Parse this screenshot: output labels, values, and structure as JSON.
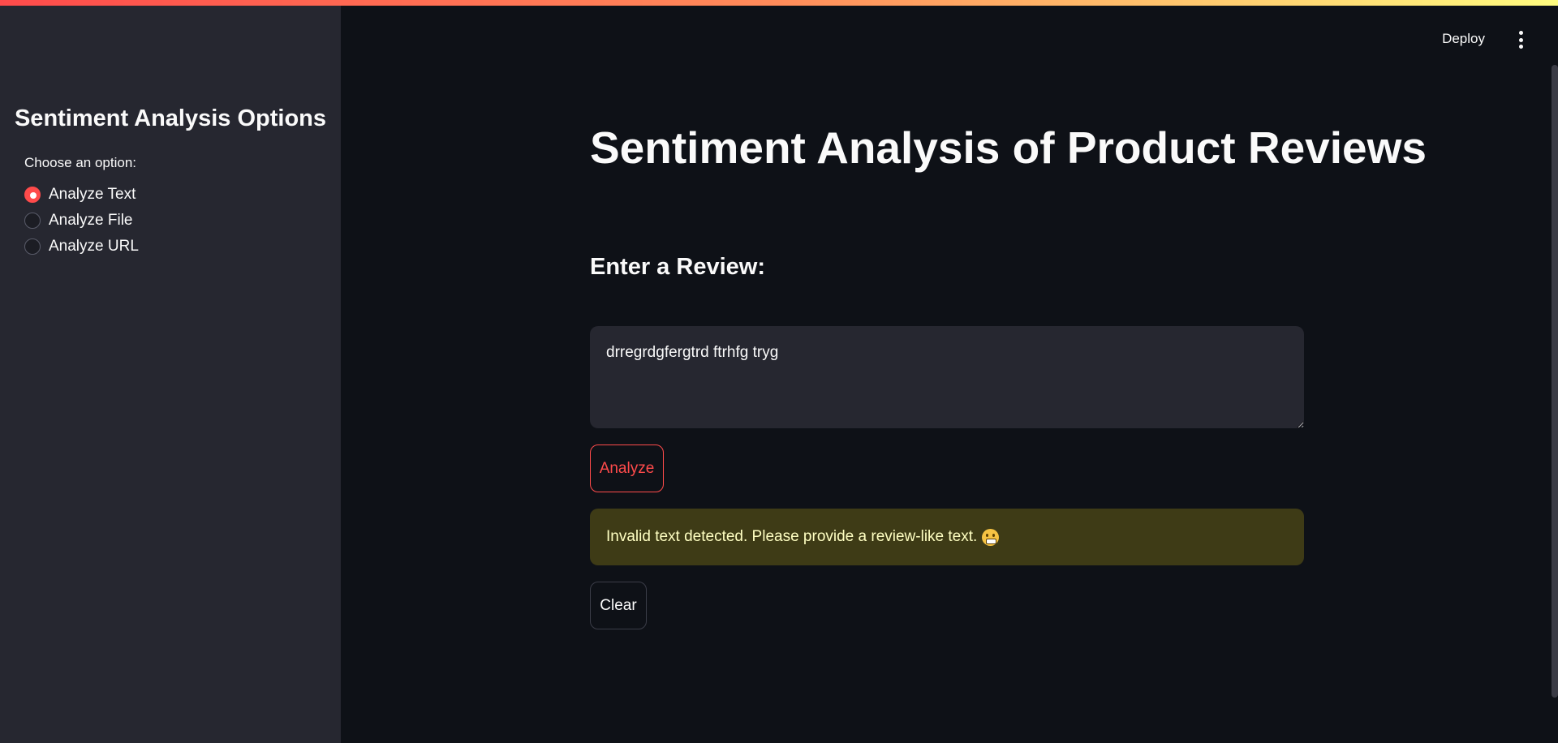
{
  "colors": {
    "primary": "#ff4b4b",
    "background": "#0e1117",
    "sidebar_background": "#262730",
    "warning_background": "#3e3b16",
    "warning_text": "#ffffc2"
  },
  "header": {
    "deploy_label": "Deploy",
    "menu_icon": "vertical-dots-icon"
  },
  "sidebar": {
    "title": "Sentiment Analysis Options",
    "radio_label": "Choose an option:",
    "options": [
      {
        "label": "Analyze Text",
        "selected": true
      },
      {
        "label": "Analyze File",
        "selected": false
      },
      {
        "label": "Analyze URL",
        "selected": false
      }
    ]
  },
  "main": {
    "title": "Sentiment Analysis of Product Reviews",
    "subheader": "Enter a Review:",
    "review_value": "drregrdgfergtrd ftrhfg tryg",
    "analyze_label": "Analyze",
    "warning_text": "Invalid text detected. Please provide a review-like text.",
    "warning_icon": "grimacing-face-icon",
    "clear_label": "Clear"
  }
}
